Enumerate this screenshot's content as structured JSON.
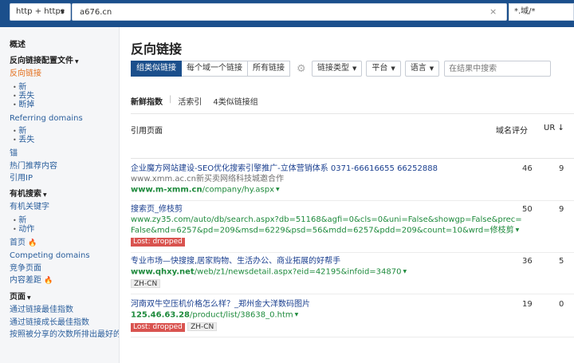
{
  "topbar": {
    "protocol": "http + https",
    "url": "a676.cn",
    "clear": "×",
    "mode": "*.域/*"
  },
  "sidebar": {
    "overview": "概述",
    "backlink_profile": "反向链接配置文件",
    "backlinks": "反向链接",
    "backlinks_sub": [
      "新",
      "丢失",
      "断掉"
    ],
    "referring_domains": "Referring domains",
    "referring_domains_sub": [
      "新",
      "丢失"
    ],
    "anchors": "锚",
    "top_content": "热门推荐内容",
    "referring_ips": "引用IP",
    "organic_search": "有机搜索",
    "organic_keywords": "有机关键字",
    "organic_keywords_sub": [
      "新",
      "动作"
    ],
    "top_pages": "首页",
    "competing_domains": "Competing domains",
    "competing_pages": "竞争页面",
    "content_gap": "内容差距",
    "pages": "页面",
    "best_by_links": "通过链接最佳指数",
    "best_by_links_growth": "通过链接成长最佳指数",
    "top_by_shares": "按照被分享的次数所排出最好的"
  },
  "main": {
    "title": "反向链接",
    "filters": {
      "groups": [
        "组类似链接",
        "每个域一个链接",
        "所有链接"
      ],
      "gear": "⚙",
      "link_type": "链接类型",
      "platform": "平台",
      "language": "语言",
      "search_placeholder": "在结果中搜索"
    },
    "subtabs": {
      "new_index": "新鲜指数",
      "sep": "|",
      "live_index": "活索引",
      "groups_count": "4类似链接组"
    },
    "columns": {
      "ref_page": "引用页面",
      "dr": "域名评分",
      "ur": "UR ↓"
    },
    "rows": [
      {
        "title": "企业魔方网站建设-SEO优化搜索引擎推广-立体营销体系 0371-66616655 66252888",
        "subtitle": "www.xmm.ac.cn新买卖网络科技城邀合作",
        "url_bold": "www.m-xmm.cn",
        "url_rest": "/company/hy.aspx",
        "dr": "46",
        "ur": "9"
      },
      {
        "title": "搜索页_修枝剪",
        "url_bold": "",
        "url_line1": "www.zy35.com/auto/db/search.aspx?db=51168&agfi=0&cls=0&uni=False&showgp=False&prec=",
        "url_line2": "False&md=6257&pd=209&msd=6229&psd=56&mdd=6257&pdd=209&count=10&wrd=修枝剪",
        "badge": "Lost: dropped",
        "dr": "50",
        "ur": "9"
      },
      {
        "title": "专业市场—快搜搜,居家购物、生活办公、商业拓展的好帮手",
        "url_bold": "www.qhxy.net",
        "url_rest": "/web/z1/newsdetail.aspx?eid=42195&infoid=34870",
        "lang": "ZH-CN",
        "dr": "36",
        "ur": "5"
      },
      {
        "title": "河南双牛空压机价格怎么样？_郑州金大洋数码图片",
        "url_bold": "125.46.63.28",
        "url_rest": "/product/list/38638_0.htm",
        "badge": "Lost: dropped",
        "lang": "ZH-CN",
        "dr": "19",
        "ur": "0"
      }
    ]
  }
}
